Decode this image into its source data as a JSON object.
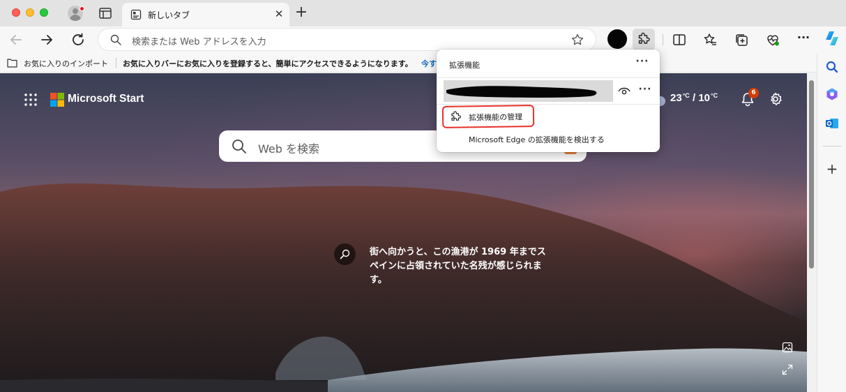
{
  "tab": {
    "title": "新しいタブ"
  },
  "address_bar": {
    "placeholder": "検索または Web アドレスを入力"
  },
  "favorites_bar": {
    "import_label": "お気に入りのインポート",
    "message": "お気に入りバーにお気に入りを登録すると、簡単にアクセスできるようになります。",
    "link_label": "今す"
  },
  "page": {
    "brand": "Microsoft Start",
    "search_placeholder": "Web を検索",
    "weather_high": "23",
    "weather_low": "10",
    "temp_unit": "°C",
    "weather_sep": "/",
    "notification_count": "6",
    "image_info": "街へ向かうと、この漁港が 1969 年までスペインに占領されていた名残が感じられます。"
  },
  "extensions_popup": {
    "title": "拡張機能",
    "manage_label": "拡張機能の管理",
    "find_label": "Microsoft Edge の拡張機能を検出する"
  },
  "colors": {
    "accent": "#0f6cbd",
    "highlight_box": "#e8302a",
    "badge": "#d83b01"
  },
  "icons": [
    "profile-icon",
    "tab-actions-icon",
    "newtab-icon",
    "back-icon",
    "forward-icon",
    "refresh-icon",
    "search-icon",
    "favorite-star-icon",
    "extensions-icon",
    "split-screen-icon",
    "favorites-icon",
    "collections-icon",
    "browser-essentials-icon",
    "more-icon",
    "copilot-icon",
    "sidebar-search-icon",
    "office-icon",
    "outlook-icon",
    "add-icon",
    "apps-grid-icon",
    "microsoft-logo-icon",
    "bell-icon",
    "settings-gear-icon",
    "eye-icon",
    "puzzle-icon",
    "image-icon",
    "expand-icon"
  ]
}
